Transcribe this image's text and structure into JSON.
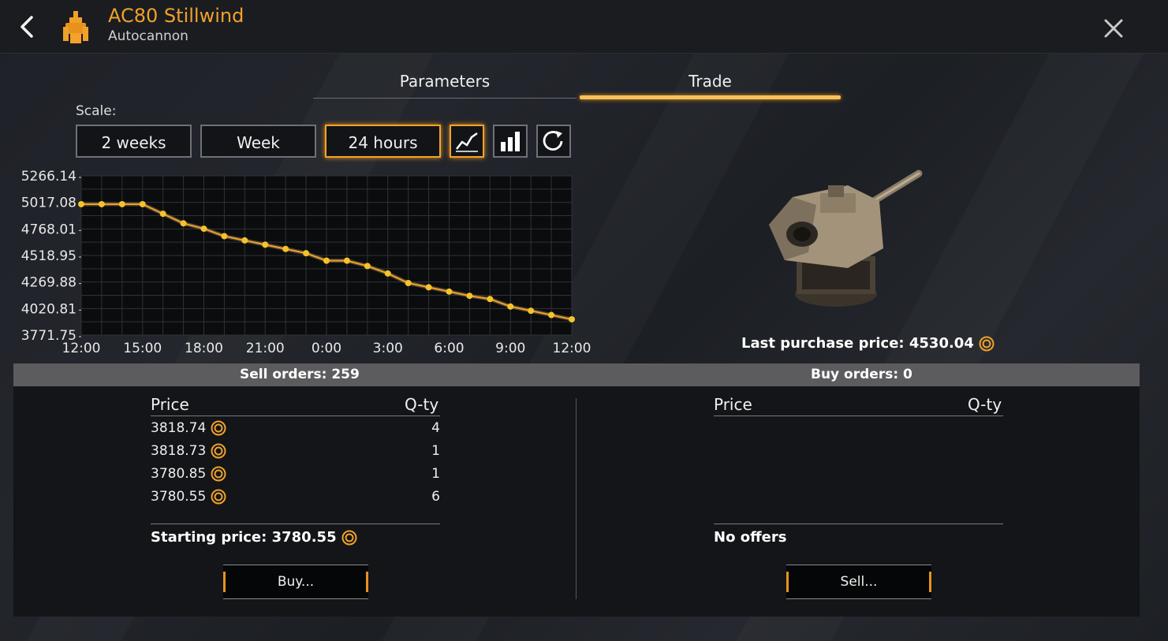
{
  "header": {
    "title": "AC80 Stillwind",
    "subtitle": "Autocannon",
    "back_icon": "chevron-left-icon",
    "close_icon": "close-icon"
  },
  "tabs": [
    {
      "label": "Parameters",
      "active": false
    },
    {
      "label": "Trade",
      "active": true
    }
  ],
  "scale": {
    "label": "Scale:",
    "options": [
      "2 weeks",
      "Week",
      "24 hours"
    ],
    "selected": "24 hours",
    "view_buttons": [
      "line-chart-icon",
      "bar-chart-icon",
      "refresh-icon"
    ],
    "active_view": "line-chart-icon"
  },
  "chart_data": {
    "type": "line",
    "x_tick_labels": [
      "12:00",
      "15:00",
      "18:00",
      "21:00",
      "0:00",
      "3:00",
      "6:00",
      "9:00",
      "12:00"
    ],
    "y_tick_labels": [
      "5266.14",
      "5017.08",
      "4768.01",
      "4518.95",
      "4269.88",
      "4020.81",
      "3771.75"
    ],
    "ylim": [
      3771.75,
      5266.14
    ],
    "x_hours": [
      0,
      1,
      2,
      3,
      4,
      5,
      6,
      7,
      8,
      9,
      10,
      11,
      12,
      13,
      14,
      15,
      16,
      17,
      18,
      19,
      20,
      21,
      22,
      23,
      24
    ],
    "values": [
      5000,
      5000,
      5000,
      5000,
      4910,
      4820,
      4770,
      4700,
      4660,
      4620,
      4580,
      4540,
      4470,
      4470,
      4420,
      4350,
      4260,
      4220,
      4180,
      4140,
      4110,
      4040,
      4000,
      3960,
      3920
    ],
    "grid": true,
    "line_color": "#f0a12a"
  },
  "trade_info": {
    "last_purchase_label": "Last purchase price: 4530.04",
    "coin_icon": "credit-coin-icon",
    "accent": "#f0a12a"
  },
  "sell": {
    "header": "Sell orders: 259",
    "col_price": "Price",
    "col_qty": "Q-ty",
    "rows": [
      {
        "price": "3818.74",
        "qty": "4"
      },
      {
        "price": "3818.73",
        "qty": "1"
      },
      {
        "price": "3780.85",
        "qty": "1"
      },
      {
        "price": "3780.55",
        "qty": "6"
      }
    ],
    "starting_price": "Starting price: 3780.55",
    "button": "Buy..."
  },
  "buy": {
    "header": "Buy orders: 0",
    "col_price": "Price",
    "col_qty": "Q-ty",
    "empty_text": "No offers",
    "button": "Sell..."
  }
}
